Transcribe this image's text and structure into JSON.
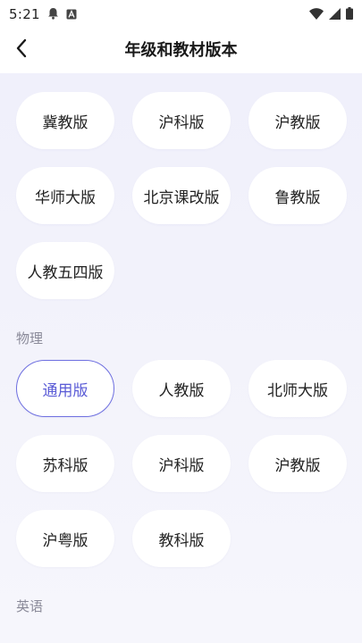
{
  "status_bar": {
    "time": "5:21",
    "icons": [
      "notification-bell-icon",
      "text-a-icon",
      "wifi-icon",
      "cellular-signal-icon",
      "battery-icon"
    ]
  },
  "navbar": {
    "back_icon": "chevron-left-icon",
    "title": "年级和教材版本"
  },
  "groups": [
    {
      "label": "",
      "options": [
        {
          "label": "冀教版",
          "selected": false
        },
        {
          "label": "沪科版",
          "selected": false
        },
        {
          "label": "沪教版",
          "selected": false
        },
        {
          "label": "华师大版",
          "selected": false
        },
        {
          "label": "北京课改版",
          "selected": false
        },
        {
          "label": "鲁教版",
          "selected": false
        },
        {
          "label": "人教五四版",
          "selected": false
        }
      ]
    },
    {
      "label": "物理",
      "options": [
        {
          "label": "通用版",
          "selected": true
        },
        {
          "label": "人教版",
          "selected": false
        },
        {
          "label": "北师大版",
          "selected": false
        },
        {
          "label": "苏科版",
          "selected": false
        },
        {
          "label": "沪科版",
          "selected": false
        },
        {
          "label": "沪教版",
          "selected": false
        },
        {
          "label": "沪粤版",
          "selected": false
        },
        {
          "label": "教科版",
          "selected": false
        }
      ]
    },
    {
      "label": "英语",
      "options": []
    }
  ],
  "colors": {
    "accent": "#6e6fe0",
    "background": "#f3f3fb",
    "section_label": "#8a8a99"
  }
}
